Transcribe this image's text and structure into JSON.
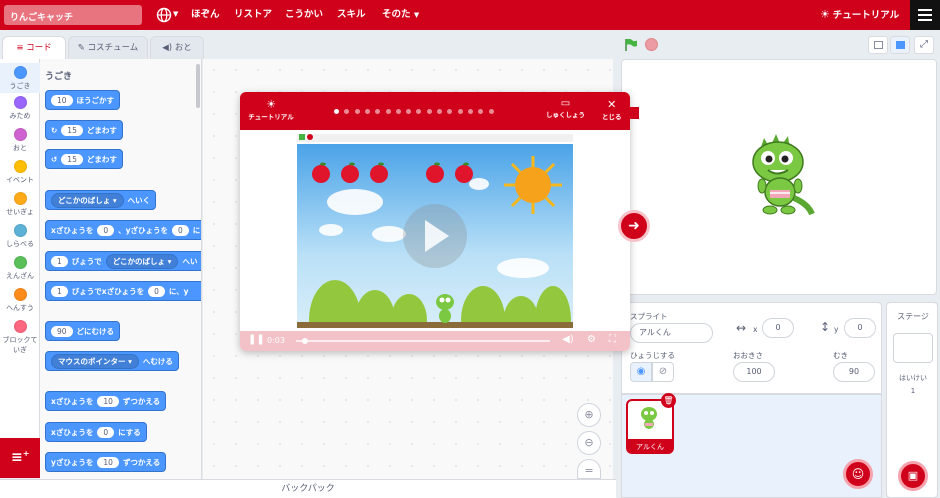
{
  "menubar": {
    "project_title": "りんごキャッチ",
    "items": [
      "ほぞん",
      "リストア",
      "こうかい",
      "スキル"
    ],
    "more_label": "そのた",
    "tutorial_label": "チュートリアル"
  },
  "tabs": {
    "code": "コード",
    "costume": "コスチューム",
    "sound": "おと"
  },
  "categories": [
    {
      "label": "うごき",
      "color": "#4c97ff"
    },
    {
      "label": "みため",
      "color": "#9966ff"
    },
    {
      "label": "おと",
      "color": "#cf63cf"
    },
    {
      "label": "イベント",
      "color": "#ffbf00"
    },
    {
      "label": "せいぎょ",
      "color": "#ffab19"
    },
    {
      "label": "しらべる",
      "color": "#5cb1d6"
    },
    {
      "label": "えんざん",
      "color": "#59c059"
    },
    {
      "label": "へんすう",
      "color": "#ff8c1a"
    },
    {
      "label": "ブロックて",
      "label2": "いぎ",
      "color": "#ff6680"
    }
  ],
  "palette": {
    "section_title": "うごき",
    "move": {
      "value": "10",
      "text": "ほうごかす"
    },
    "turn_right": {
      "value": "15",
      "text": "どまわす"
    },
    "turn_left": {
      "value": "15",
      "text": "どまわす"
    },
    "goto": {
      "dropdown": "どこかのばしょ",
      "text": "へいく"
    },
    "goto_xy": {
      "t1": "xざひょうを",
      "x": "0",
      "t2": "、yざひょうを",
      "y": "0",
      "t3": "にする"
    },
    "glide_to": {
      "secs": "1",
      "t1": "びょうで",
      "dropdown": "どこかのばしょ",
      "t2": "へい"
    },
    "glide_xy": {
      "secs": "1",
      "t1": "びょうでxざひょうを",
      "x": "0",
      "t2": "に、y"
    },
    "point_dir": {
      "value": "90",
      "text": "どにむける"
    },
    "point_towards": {
      "dropdown": "マウスのポインター",
      "text": "へむける"
    },
    "change_x": {
      "t1": "xざひょうを",
      "value": "10",
      "t2": "ずつかえる"
    },
    "set_x": {
      "t1": "xざひょうを",
      "value": "0",
      "t2": "にする"
    },
    "change_y": {
      "t1": "yざひょうを",
      "value": "10",
      "t2": "ずつかえる"
    }
  },
  "backpack_label": "バックパック",
  "tutorial": {
    "header_label": "チュートリアル",
    "show_label": "しゅくしょう",
    "close_label": "とじる",
    "step_count": 16,
    "current_step": 1,
    "time": "0:03"
  },
  "sprite_info": {
    "sprite_label": "スプライト",
    "name": "アルくん",
    "x_label": "x",
    "x_value": "0",
    "y_label": "y",
    "y_value": "0",
    "show_label": "ひょうじする",
    "size_label": "おおきさ",
    "size_value": "100",
    "direction_label": "むき",
    "direction_value": "90"
  },
  "sprite_tile": {
    "name": "アルくん"
  },
  "stage_pane": {
    "title": "ステージ",
    "backdrops_label": "はいけい",
    "backdrops_count": "1"
  },
  "colors": {
    "brand": "#d0021b",
    "motion": "#4c97ff"
  }
}
